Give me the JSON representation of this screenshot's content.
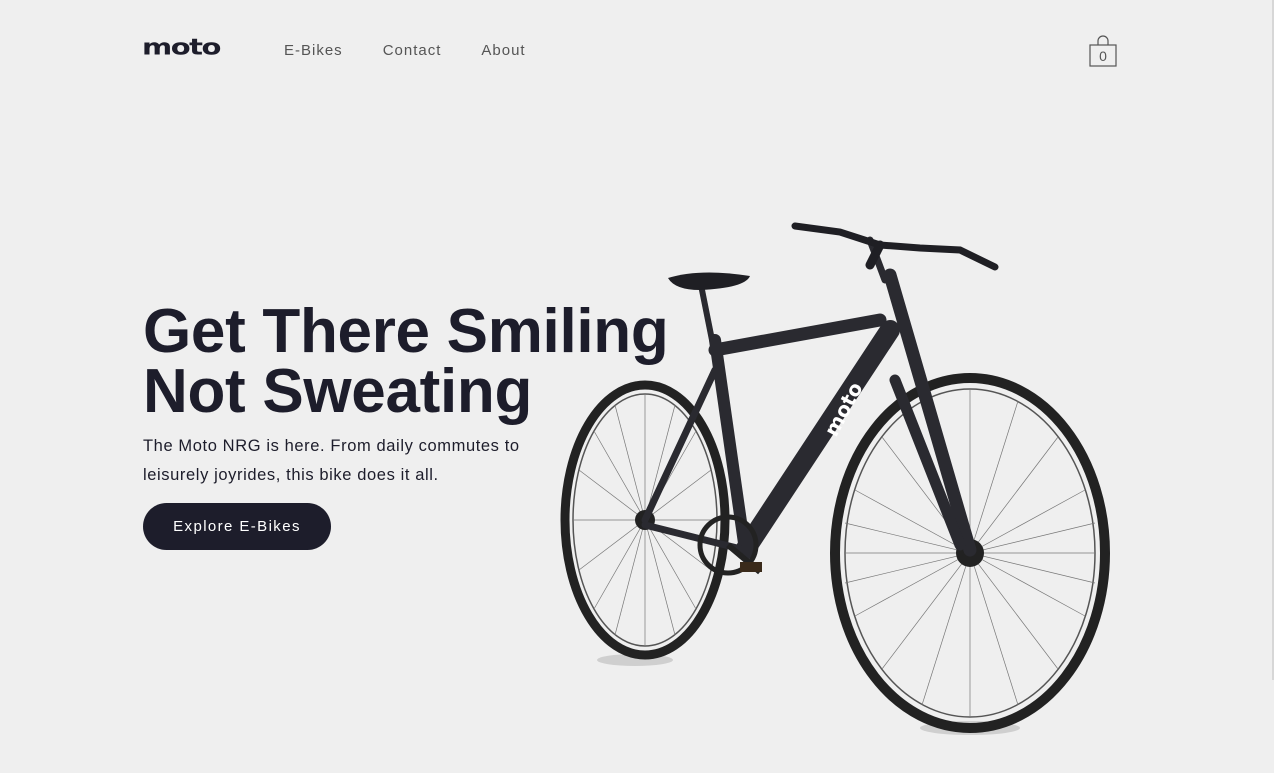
{
  "brand": {
    "logo_text": "moto"
  },
  "nav": {
    "items": [
      {
        "label": "E-Bikes"
      },
      {
        "label": "Contact"
      },
      {
        "label": "About"
      }
    ]
  },
  "cart": {
    "count": "0",
    "icon": "shopping-bag-icon"
  },
  "hero": {
    "title_line1": "Get There Smiling",
    "title_line2": "Not Sweating",
    "subtitle": "The Moto NRG is here. From daily commutes to leisurely joyrides, this bike does it all.",
    "cta_label": "Explore E-Bikes",
    "frame_logo": "moto"
  },
  "colors": {
    "background": "#efefef",
    "primary": "#1d1d2b",
    "nav_text": "#555555",
    "button_text": "#ffffff"
  }
}
